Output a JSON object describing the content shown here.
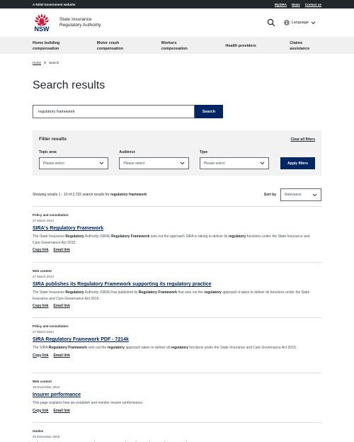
{
  "topbar": {
    "label": "A NSW Government website",
    "links": [
      "MySIRA",
      "News",
      "Contact us"
    ]
  },
  "masthead": {
    "logo_text": "NSW",
    "agency_line1": "State Insurance",
    "agency_line2": "Regulatory Authority",
    "language_label": "Language"
  },
  "nav": {
    "items": [
      {
        "line1": "Home building",
        "line2": "compensation"
      },
      {
        "line1": "Motor crash",
        "line2": "compensation"
      },
      {
        "line1": "Workers",
        "line2": "compensation"
      },
      {
        "line1": "Health providers",
        "line2": ""
      },
      {
        "line1": "Claims",
        "line2": "assistance"
      }
    ]
  },
  "breadcrumb": {
    "home": "Home",
    "current": "Search"
  },
  "page_title": "Search results",
  "search": {
    "value": "regulatory framework",
    "button": "Search"
  },
  "filters": {
    "title": "Filter results",
    "clear": "Clear all filters",
    "topic": {
      "label": "Topic area",
      "value": "Please select"
    },
    "audience": {
      "label": "Audience",
      "value": "Please select"
    },
    "type": {
      "label": "Type",
      "value": "Please select"
    },
    "apply": "Apply filters"
  },
  "summary": {
    "prefix": "Showing results 1 - 10 of 2,722 search results for",
    "query": "regulatory framework",
    "sort_label": "Sort by",
    "sort_value": "Relevance"
  },
  "results": [
    {
      "type": "Policy and consultation",
      "date": "27 March 2024",
      "title": "SIRA's Regulatory Framework",
      "desc_parts": [
        [
          "The State Insurance ",
          false
        ],
        [
          "Regulatory",
          true
        ],
        [
          " Authority (SIRA) ",
          false
        ],
        [
          "Regulatory Framework",
          true
        ],
        [
          " sets out the approach SIRA is taking to deliver its ",
          false
        ],
        [
          "regulatory",
          true
        ],
        [
          " functions under the State Insurance and Care Governance Act 2015.",
          false
        ]
      ],
      "copy": "Copy link",
      "email": "Email link"
    },
    {
      "type": "Web content",
      "date": "27 March 2024",
      "title": "SIRA publishes its Regulatory Framework supporting its regulatory practice",
      "desc_parts": [
        [
          "The State Insurance ",
          false
        ],
        [
          "Regulatory",
          true
        ],
        [
          " Authority (SIRA) has published its ",
          false
        ],
        [
          "Regulatory Framework",
          true
        ],
        [
          " that sets out the ",
          false
        ],
        [
          "regulatory",
          true
        ],
        [
          " approach it takes to deliver its functions under the State Insurance and Care Governance Act 2015.",
          false
        ]
      ],
      "copy": "Copy link",
      "email": "Email link"
    },
    {
      "type": "Policy and consultation",
      "date": "27 March 2024",
      "title": "SIRA Regulatory Framework PDF - 7214k",
      "desc_parts": [
        [
          "The SIRA ",
          false
        ],
        [
          "Regulatory Framework",
          true
        ],
        [
          " sets out the ",
          false
        ],
        [
          "regulatory",
          true
        ],
        [
          " approach taken to deliver all ",
          false
        ],
        [
          "regulatory",
          true
        ],
        [
          " functions under the State Insurance and Care Governance Act 2015.",
          false
        ]
      ],
      "copy": "Copy link",
      "email": "Email link"
    },
    {
      "type": "Web content",
      "date": "18 November 2024",
      "title": "Insurer performance",
      "desc_parts": [
        [
          "This page explains how we establish and monitor insurer performance.",
          false
        ]
      ],
      "copy": "Copy link",
      "email": "Email link"
    },
    {
      "type": "Guides",
      "date": "03 December 2019",
      "title": "Injury management consultant approval and regulatory framework",
      "desc_parts": [],
      "copy": "",
      "email": ""
    }
  ],
  "colors": {
    "brand_navy": "#002664",
    "brand_red": "#d7153a",
    "text": "#22272b"
  }
}
